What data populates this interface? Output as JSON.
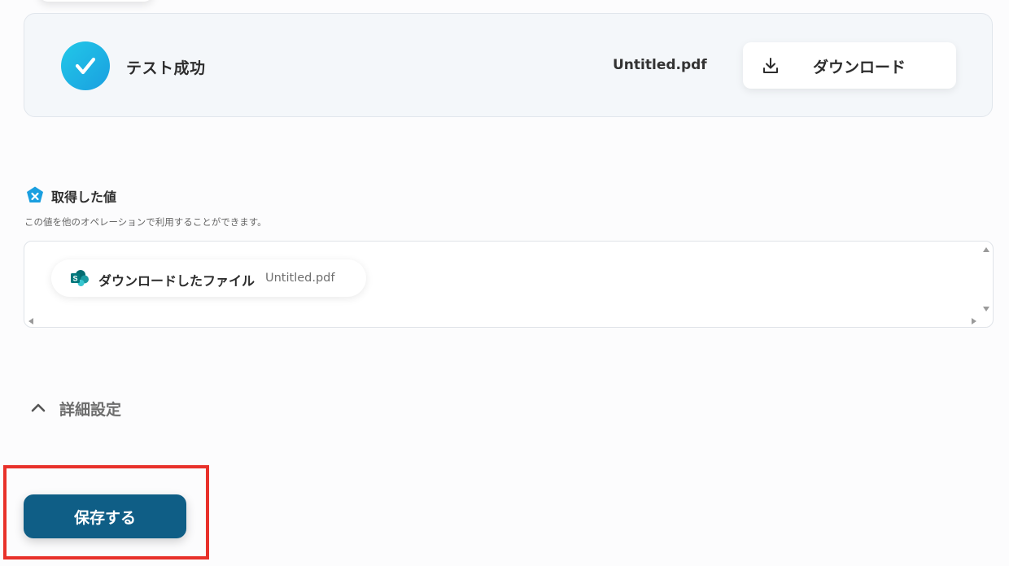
{
  "test_result": {
    "status_label": "テスト成功",
    "filename": "Untitled.pdf",
    "download_button_label": "ダウンロード"
  },
  "retrieved_values": {
    "title": "取得した値",
    "description": "この値を他のオペレーションで利用することができます。",
    "items": [
      {
        "label": "ダウンロードしたファイル",
        "value": "Untitled.pdf",
        "icon": "sharepoint-icon"
      }
    ]
  },
  "advanced_settings": {
    "label": "詳細設定",
    "icon": "chevron-up-icon"
  },
  "save": {
    "label": "保存する"
  },
  "colors": {
    "accent": "#0f5e86",
    "success": "#22c8e8",
    "highlight": "#e8312a"
  }
}
